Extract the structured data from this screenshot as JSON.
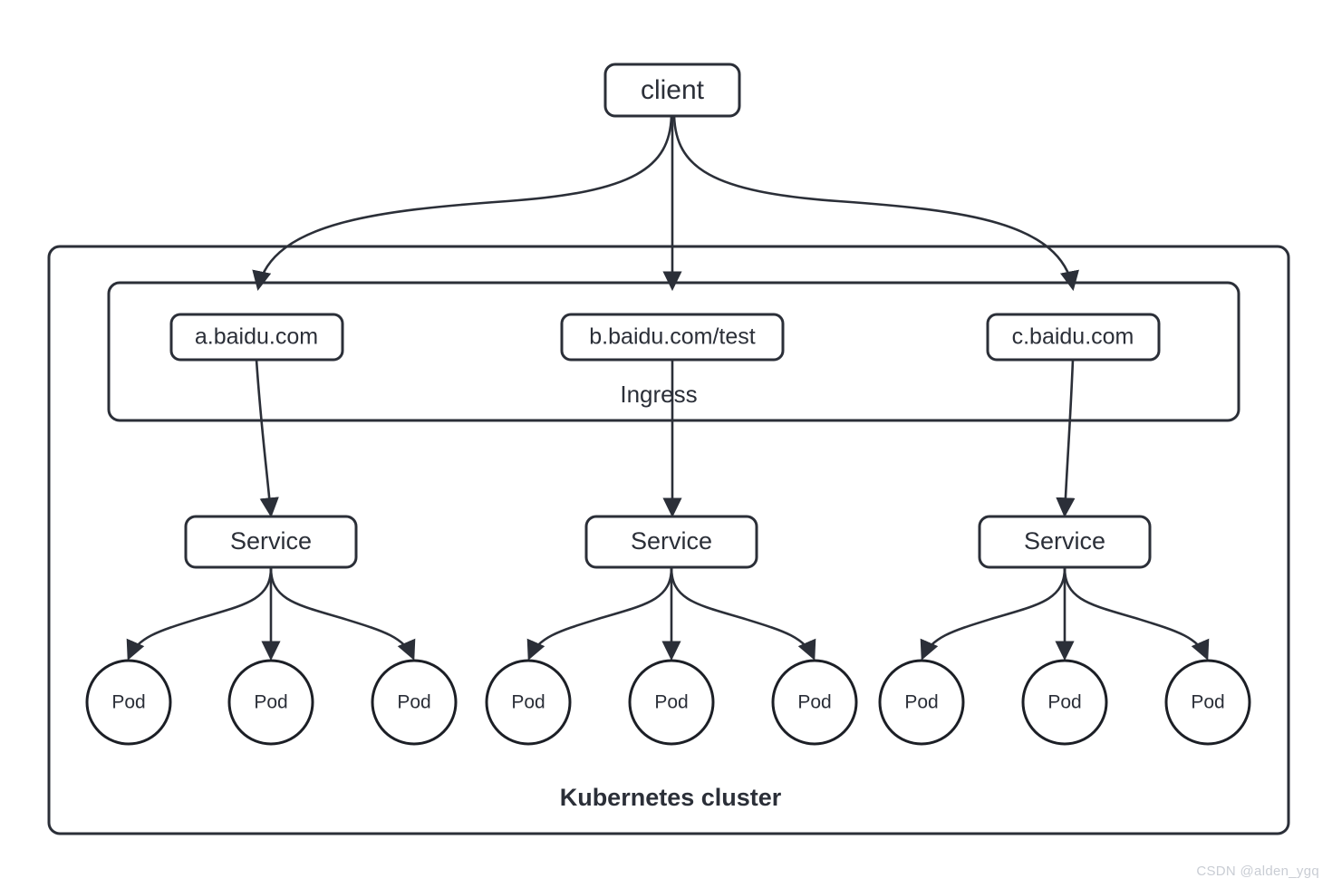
{
  "diagram": {
    "title": "Kubernetes Ingress routing diagram",
    "background_color": "#ffffff",
    "stroke_color": "#2b2f38",
    "watermark": "CSDN @alden_ygq"
  },
  "client": {
    "label": "client"
  },
  "cluster": {
    "label": "Kubernetes cluster"
  },
  "ingress": {
    "label": "Ingress",
    "rules": [
      {
        "host": "a.baidu.com"
      },
      {
        "host": "b.baidu.com/test"
      },
      {
        "host": "c.baidu.com"
      }
    ]
  },
  "services": [
    {
      "label": "Service",
      "pods": [
        {
          "label": "Pod"
        },
        {
          "label": "Pod"
        },
        {
          "label": "Pod"
        }
      ]
    },
    {
      "label": "Service",
      "pods": [
        {
          "label": "Pod"
        },
        {
          "label": "Pod"
        },
        {
          "label": "Pod"
        }
      ]
    },
    {
      "label": "Service",
      "pods": [
        {
          "label": "Pod"
        },
        {
          "label": "Pod"
        },
        {
          "label": "Pod"
        }
      ]
    }
  ]
}
